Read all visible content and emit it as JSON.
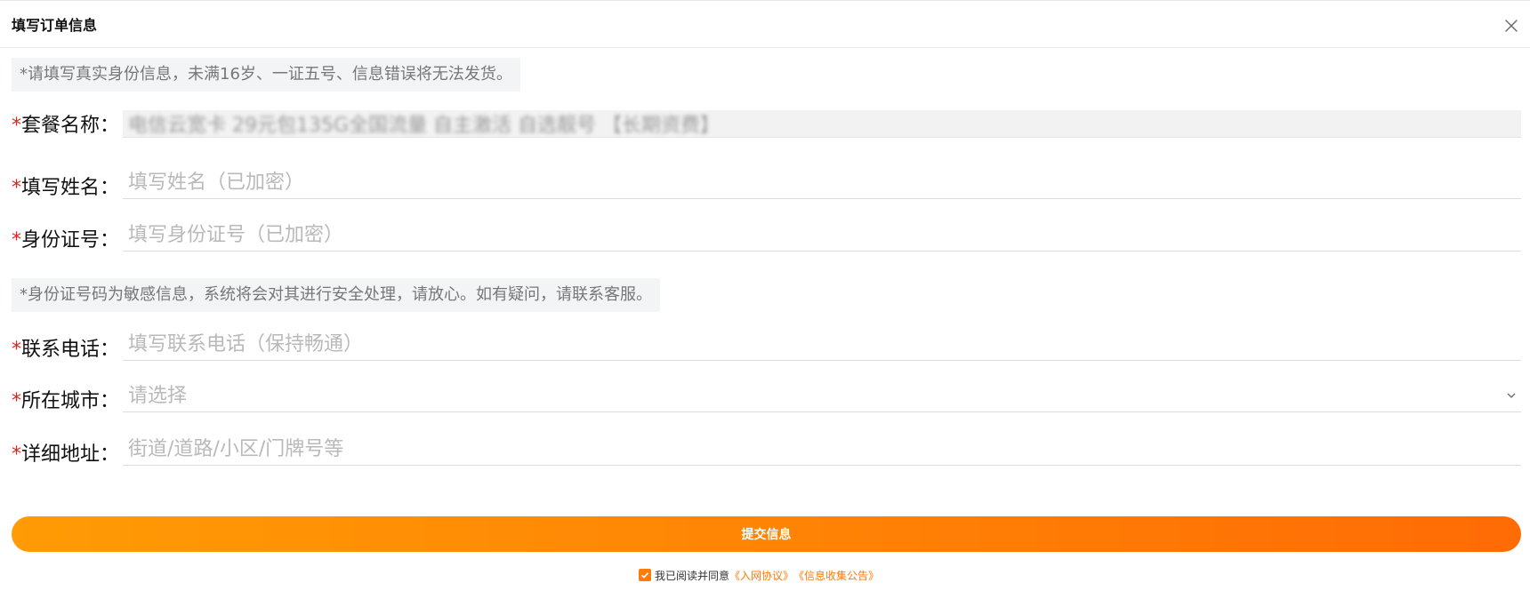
{
  "header": {
    "title": "填写订单信息"
  },
  "notices": {
    "top": "*请填写真实身份信息，未满16岁、一证五号、信息错误将无法发货。",
    "middle": "*身份证号码为敏感信息，系统将会对其进行安全处理，请放心。如有疑问，请联系客服。"
  },
  "form": {
    "plan": {
      "label": "套餐名称：",
      "value": "电信云宽卡 29元包135G全国流量 自主激活 自选靓号 【长期资费】"
    },
    "name": {
      "label": "填写姓名：",
      "placeholder": "填写姓名（已加密）"
    },
    "id_number": {
      "label": "身份证号：",
      "placeholder": "填写身份证号（已加密）"
    },
    "phone": {
      "label": "联系电话：",
      "placeholder": "填写联系电话（保持畅通）"
    },
    "city": {
      "label": "所在城市：",
      "placeholder": "请选择"
    },
    "address": {
      "label": "详细地址：",
      "placeholder": "街道/道路/小区/门牌号等"
    },
    "required_mark": "*"
  },
  "submit": {
    "label": "提交信息"
  },
  "agreement": {
    "prefix": "我已阅读并同意",
    "link1": "《入网协议》",
    "link2": "《信息收集公告》",
    "checked": true
  },
  "colors": {
    "accent": "#ff7b0a",
    "required": "#e0231c",
    "gradient_start": "#ff9b05",
    "gradient_end": "#ff6b05"
  },
  "icons": {
    "close": "close-icon",
    "chevron": "chevron-down-icon",
    "check": "check-icon"
  }
}
